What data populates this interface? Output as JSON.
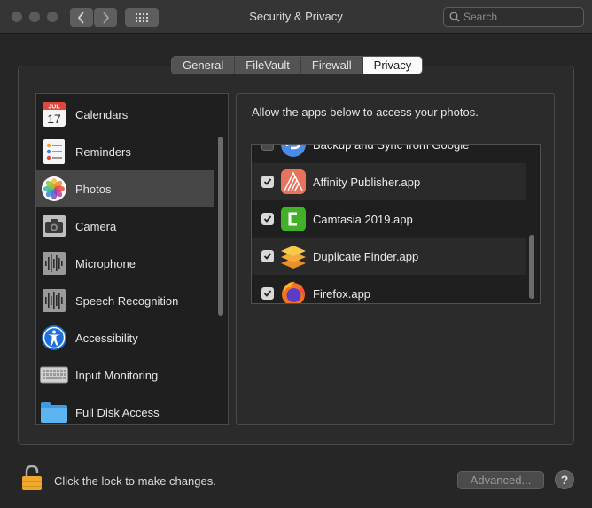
{
  "window": {
    "title": "Security & Privacy"
  },
  "toolbar": {
    "back_icon": "chevron-left-icon",
    "forward_icon": "chevron-right-icon",
    "grid_icon": "grid-icon"
  },
  "search": {
    "placeholder": "Search",
    "value": ""
  },
  "tabs": [
    {
      "label": "General",
      "active": false
    },
    {
      "label": "FileVault",
      "active": false
    },
    {
      "label": "Firewall",
      "active": false
    },
    {
      "label": "Privacy",
      "active": true
    }
  ],
  "sidebar": {
    "selected": "Photos",
    "items": [
      {
        "label": "Calendars",
        "icon": "calendar-icon",
        "calendar_month": "JUL",
        "calendar_day": "17"
      },
      {
        "label": "Reminders",
        "icon": "reminders-icon"
      },
      {
        "label": "Photos",
        "icon": "photos-icon"
      },
      {
        "label": "Camera",
        "icon": "camera-icon"
      },
      {
        "label": "Microphone",
        "icon": "microphone-icon"
      },
      {
        "label": "Speech Recognition",
        "icon": "speech-recognition-icon"
      },
      {
        "label": "Accessibility",
        "icon": "accessibility-icon"
      },
      {
        "label": "Input Monitoring",
        "icon": "keyboard-icon"
      },
      {
        "label": "Full Disk Access",
        "icon": "folder-icon"
      }
    ]
  },
  "panel": {
    "description": "Allow the apps below to access your photos.",
    "apps": [
      {
        "name": "Backup and Sync from Google",
        "checked": false,
        "icon": "backup-sync-icon"
      },
      {
        "name": "Affinity Publisher.app",
        "checked": true,
        "icon": "affinity-publisher-icon"
      },
      {
        "name": "Camtasia 2019.app",
        "checked": true,
        "icon": "camtasia-icon"
      },
      {
        "name": "Duplicate Finder.app",
        "checked": true,
        "icon": "duplicate-finder-icon"
      },
      {
        "name": "Firefox.app",
        "checked": true,
        "icon": "firefox-icon"
      }
    ]
  },
  "footer": {
    "lock_text": "Click the lock to make changes.",
    "advanced_label": "Advanced...",
    "help_label": "?"
  },
  "colors": {
    "window_bg": "#262626",
    "selected_row": "#464646",
    "tab_active_bg": "#fbfbfb"
  }
}
